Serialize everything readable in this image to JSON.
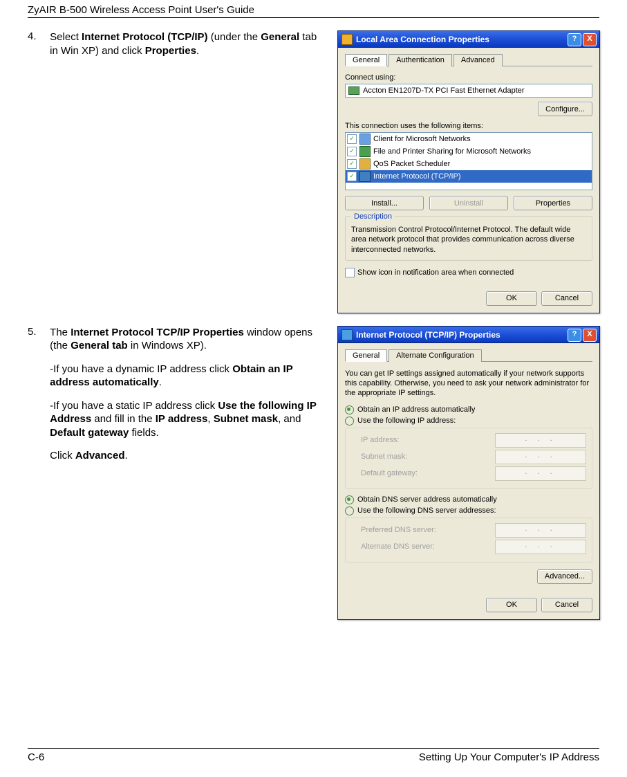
{
  "doc": {
    "header": "ZyAIR B-500 Wireless Access Point User's Guide",
    "footer_left": "C-6",
    "footer_right": "Setting Up Your Computer's IP Address"
  },
  "step4": {
    "num": "4.",
    "text_pre": "Select ",
    "bold1": "Internet Protocol (TCP/IP)",
    "text_mid": " (under the ",
    "bold2": "General",
    "text_mid2": " tab in Win XP) and click ",
    "bold3": "Properties",
    "text_post": "."
  },
  "step5": {
    "num": "5.",
    "p1_pre": "The ",
    "p1_b1": "Internet Protocol TCP/IP Properties",
    "p1_mid": " window opens (the ",
    "p1_b2": "General tab",
    "p1_post": " in Windows XP).",
    "p2_pre": "-If you have a dynamic IP address click ",
    "p2_b1": "Obtain an IP address automatically",
    "p2_post": ".",
    "p3_pre": "-If you have a static IP address click ",
    "p3_b1": "Use the following IP Address",
    "p3_mid": " and fill in the ",
    "p3_b2": "IP address",
    "p3_sep1": ", ",
    "p3_b3": "Subnet mask",
    "p3_sep2": ", and ",
    "p3_b4": "Default gateway",
    "p3_post": " fields.",
    "p4_pre": "Click ",
    "p4_b1": "Advanced",
    "p4_post": "."
  },
  "dlg1": {
    "title": "Local Area Connection Properties",
    "tab_general": "General",
    "tab_auth": "Authentication",
    "tab_adv": "Advanced",
    "connect_using": "Connect using:",
    "adapter": "Accton EN1207D-TX PCI Fast Ethernet Adapter",
    "configure": "Configure...",
    "items_label": "This connection uses the following items:",
    "item1": "Client for Microsoft Networks",
    "item2": "File and Printer Sharing for Microsoft Networks",
    "item3": "QoS Packet Scheduler",
    "item4": "Internet Protocol (TCP/IP)",
    "install": "Install...",
    "uninstall": "Uninstall",
    "properties": "Properties",
    "desc_title": "Description",
    "desc_text": "Transmission Control Protocol/Internet Protocol. The default wide area network protocol that provides communication across diverse interconnected networks.",
    "show_icon": "Show icon in notification area when connected",
    "ok": "OK",
    "cancel": "Cancel"
  },
  "dlg2": {
    "title": "Internet Protocol (TCP/IP) Properties",
    "tab_general": "General",
    "tab_alt": "Alternate Configuration",
    "intro": "You can get IP settings assigned automatically if your network supports this capability. Otherwise, you need to ask your network administrator for the appropriate IP settings.",
    "r_obtain_ip": "Obtain an IP address automatically",
    "r_use_ip": "Use the following IP address:",
    "f_ip": "IP address:",
    "f_mask": "Subnet mask:",
    "f_gw": "Default gateway:",
    "r_obtain_dns": "Obtain DNS server address automatically",
    "r_use_dns": "Use the following DNS server addresses:",
    "f_pdns": "Preferred DNS server:",
    "f_adns": "Alternate DNS server:",
    "advanced": "Advanced...",
    "ok": "OK",
    "cancel": "Cancel",
    "dots": ".   .   ."
  }
}
